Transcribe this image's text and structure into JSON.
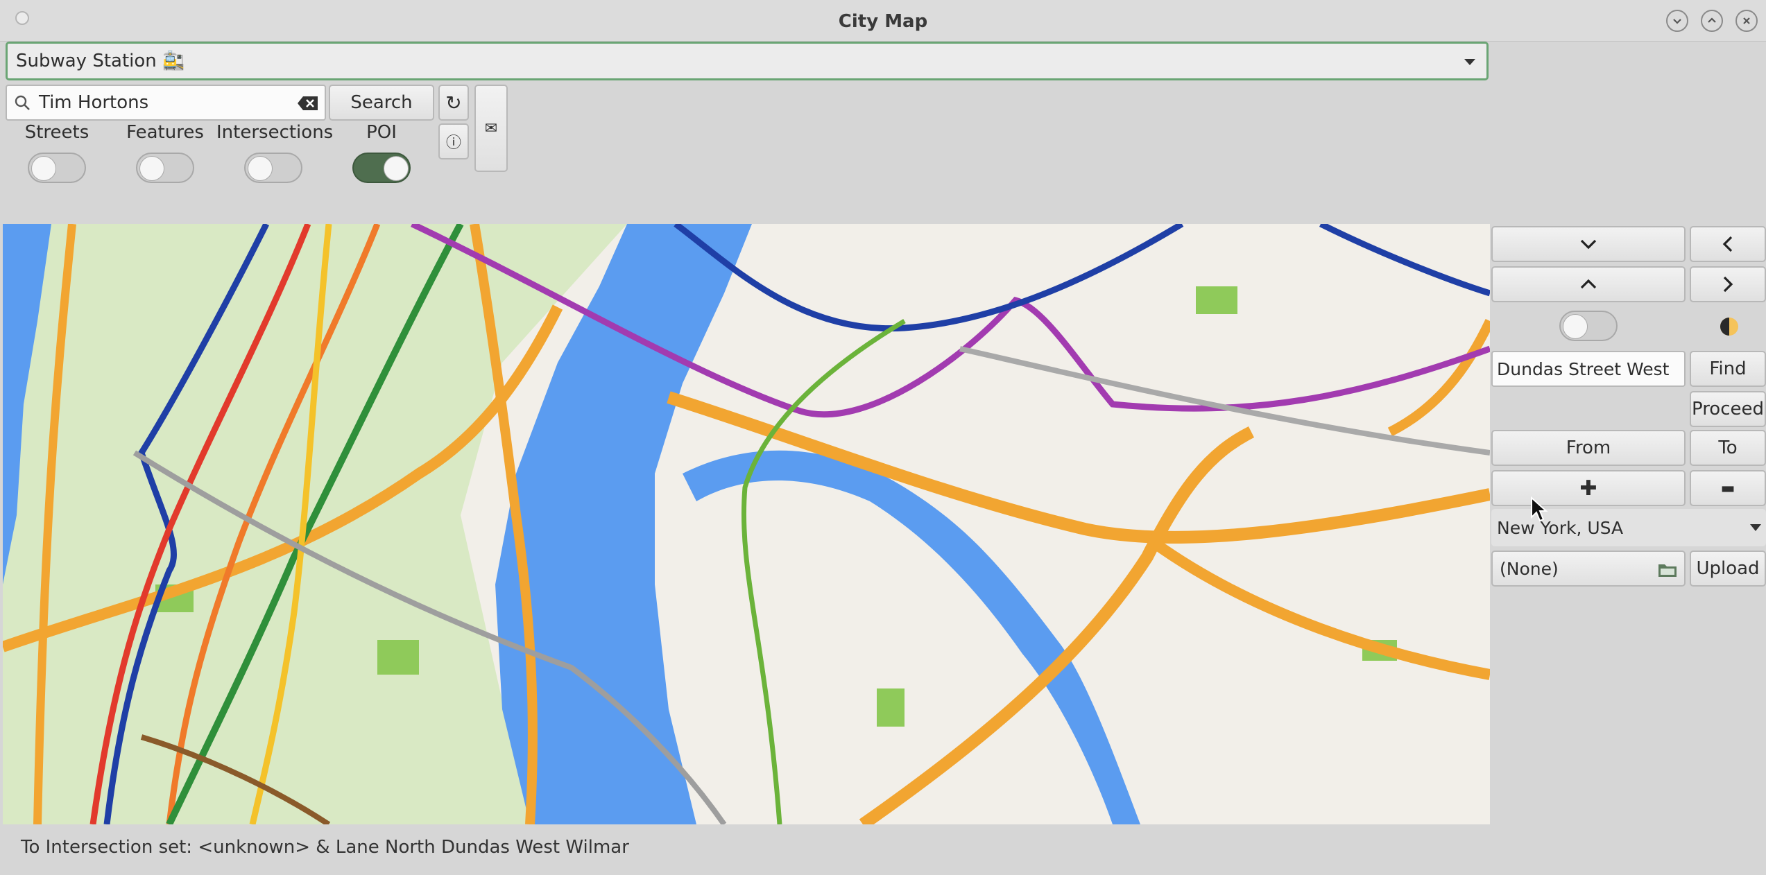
{
  "window": {
    "title": "City Map",
    "controls": [
      "minimize-icon",
      "maximize-icon",
      "close-icon"
    ]
  },
  "poi_type_combo": {
    "value": "Subway Station 🚉"
  },
  "search": {
    "value": "Tim Hortons",
    "button_label": "Search",
    "refresh_icon": "↻",
    "info_icon": "ⓘ",
    "mail_icon": "✉"
  },
  "toggles": [
    {
      "label": "Streets",
      "on": false
    },
    {
      "label": "Features",
      "on": false
    },
    {
      "label": "Intersections",
      "on": false
    },
    {
      "label": "POI",
      "on": true
    }
  ],
  "side_panel": {
    "down_icon": "chevron-down-icon",
    "up_icon": "chevron-up-icon",
    "left_icon": "chevron-left-icon",
    "right_icon": "chevron-right-icon",
    "theme_icon": "contrast-icon",
    "street_field": "Dundas Street West",
    "find_label": "Find",
    "proceed_label": "Proceed",
    "from_label": "From",
    "to_label": "To",
    "zoom_in": "✚",
    "zoom_out": "▬",
    "city_select": "New York, USA",
    "file_value": "(None)",
    "upload_label": "Upload"
  },
  "status_bar": {
    "text": "To Intersection set: <unknown> & Lane North Dundas West Wilmar"
  },
  "colors": {
    "water": "#5b9cf0",
    "park": "#a8d672",
    "land": "#f2efe9",
    "highway": "#f2a531",
    "subway_blue": "#1f3fa6",
    "subway_red": "#e23a2c",
    "subway_green": "#2f8f3a",
    "subway_purple": "#a23bb0",
    "subway_yellow": "#f4c22a",
    "accent_green": "#6aa574"
  }
}
